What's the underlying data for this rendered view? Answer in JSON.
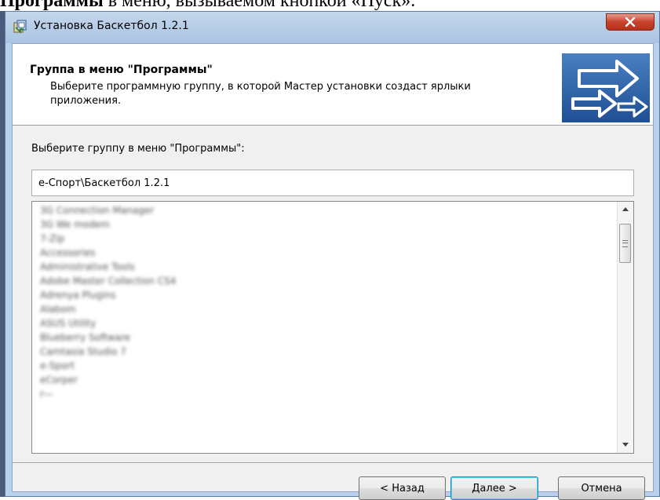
{
  "document": {
    "text_bold": "Программы",
    "text_rest": " в меню, вызываемом кнопкой «Пуск»."
  },
  "window": {
    "title": "Установка Баскетбол 1.2.1",
    "close_label": "x"
  },
  "header": {
    "title": "Группа в меню \"Программы\"",
    "subtitle": "Выберите программную группу, в которой Мастер установки создаст ярлыки приложения."
  },
  "prompt": "Выберите группу в меню \"Программы\":",
  "group_input": {
    "value": "e-Спорт\\Баскетбол 1.2.1"
  },
  "program_list": {
    "items": [
      "3G Connection Manager",
      "3G We modem",
      "7-Zip",
      "Accessories",
      "Administrative Tools",
      "Adobe Master Collection CS4",
      "Adrenya Plugins",
      "Alabom",
      "ASUS Utility",
      "Blueberry Software",
      "Camtasia Studio 7",
      "e-Sport",
      "eCorper",
      "r—"
    ]
  },
  "buttons": {
    "back": "< Назад",
    "next": "Далее >",
    "cancel": "Отмена"
  }
}
